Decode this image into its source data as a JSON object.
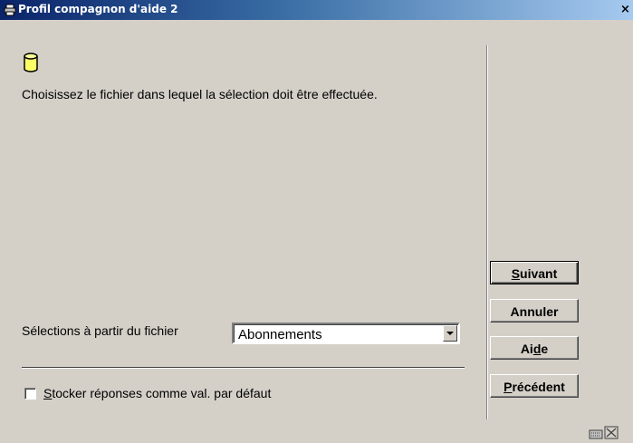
{
  "window": {
    "title": "Profil compagnon d'aide 2",
    "close_glyph": "×",
    "title_icon": "printer-app-icon"
  },
  "main": {
    "icon": "database-cylinder-icon",
    "instruction": "Choisissez le fichier dans lequel la sélection doit être effectuée.",
    "selection_label": "Sélections à partir du fichier",
    "selection_value": "Abonnements",
    "checkbox_checked": false,
    "checkbox_label_mnemonic": "S",
    "checkbox_label_rest": "tocker réponses comme val. par défaut"
  },
  "buttons": {
    "next": {
      "mnemonic": "S",
      "rest": "uivant"
    },
    "cancel": {
      "label": "Annuler"
    },
    "help": {
      "before": "Ai",
      "mnemonic": "d",
      "after": "e"
    },
    "previous": {
      "mnemonic": "P",
      "rest": "récédent"
    }
  },
  "status_bar": {
    "icons": [
      "keyboard-icon",
      "resize-grip-icon"
    ]
  },
  "colors": {
    "face": "#d4d0c8",
    "title_start": "#0a246a",
    "title_end": "#a6caf0",
    "db_icon_fill": "#ffff66"
  }
}
